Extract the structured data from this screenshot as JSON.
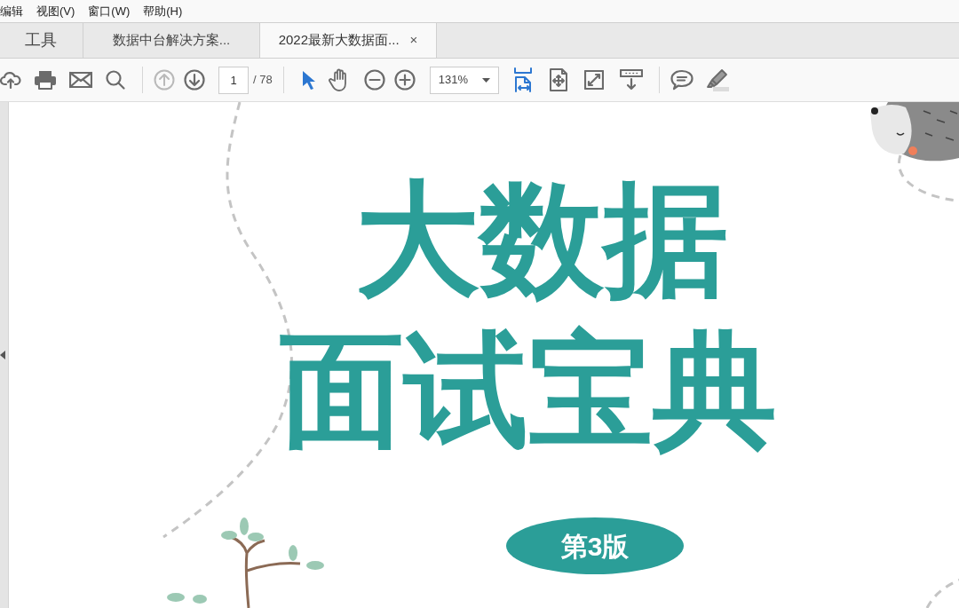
{
  "menu": [
    "编辑",
    "视图(V)",
    "窗口(W)",
    "帮助(H)"
  ],
  "tabs": [
    {
      "label": "工具",
      "kind": "tools",
      "selected": false
    },
    {
      "label": "数据中台解决方案...",
      "kind": "doc",
      "selected": false
    },
    {
      "label": "2022最新大数据面...",
      "kind": "doc",
      "selected": true,
      "close": "×"
    }
  ],
  "toolbar": {
    "page": "1",
    "page_total": "/ 78",
    "zoom": "131%",
    "tools": [
      {
        "active": true
      },
      {
        "active": false
      },
      {
        "active": true
      },
      {
        "active": false
      }
    ]
  },
  "document": {
    "title_lines": [
      "大数据",
      "面试宝典"
    ],
    "edition": "第3版"
  }
}
